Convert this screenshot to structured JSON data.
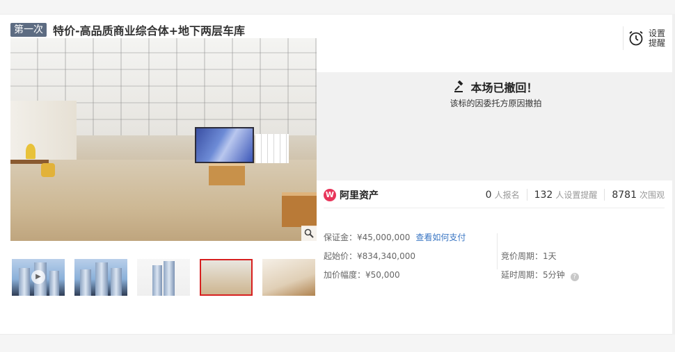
{
  "header": {
    "round_tag": "第一次",
    "title": "特价-高品质商业综合体+地下两层车库"
  },
  "reminder": {
    "label": "设置提醒"
  },
  "status": {
    "title": "本场已撤回！",
    "subtitle": "该标的因委托方原因撤拍"
  },
  "platform": {
    "name": "阿里资产"
  },
  "stats": [
    {
      "value": "0",
      "label": "人报名"
    },
    {
      "value": "132",
      "label": "人设置提醒"
    },
    {
      "value": "8781",
      "label": "次围观"
    }
  ],
  "details": {
    "deposit": "保证金：¥45,000,000",
    "pay_link": "查看如何支付",
    "start_price": "起始价：¥834,340,000",
    "bid_cycle": "竞价周期：1天",
    "increment": "加价幅度：¥50,000",
    "delay_cycle": "延时周期：5分钟"
  },
  "gallery": {
    "thumbnail_count": 5,
    "active_index": 3
  },
  "colors": {
    "tag_bg": "#5d6c82",
    "link": "#3a76c3",
    "active_border": "#d71f1f",
    "brand": "#e8355a"
  }
}
